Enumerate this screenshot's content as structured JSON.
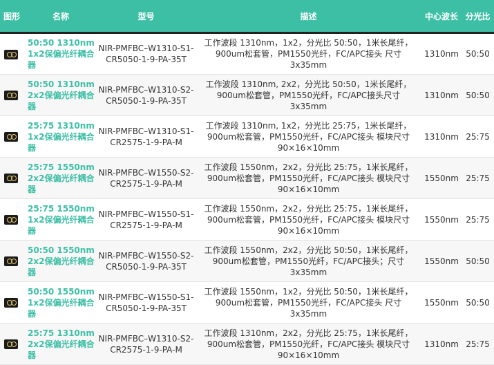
{
  "headers": {
    "shape": "图形",
    "name": "名称",
    "model": "型号",
    "desc": "描述",
    "wavelength": "中心波长",
    "ratio": "分光比"
  },
  "colors": {
    "accent": "#3dbfa6",
    "header_text": "#ffffff"
  },
  "rows": [
    {
      "icon": "coupler-thumbnail",
      "name": "50:50 1310nm 1x2保偏光纤耦合器",
      "model": "NIR-PMFBC–W1310-S1-CR5050-1-9-PA-35T",
      "desc": "工作波段 1310nm，1x2，分光比 50:50，1米长尾纤，900um松套管，PM1550光纤，FC/APC接头 尺寸 3x35mm",
      "wavelength": "1310nm",
      "ratio": "50:50"
    },
    {
      "icon": "coupler-thumbnail",
      "name": "50:50 1310nm 2x2保偏光纤耦合器",
      "model": "NIR-PMFBC–W1310-S2-CR5050-1-9-PA-35T",
      "desc": "工作波段 1310nm, 2x2，分光比 50:50，1米长尾纤，900um松套管，PM1550光纤，FC/APC接头尺寸 3x35mm",
      "wavelength": "1310nm",
      "ratio": "50:50"
    },
    {
      "icon": "coupler-thumbnail",
      "name": "25:75 1310nm 1x2保偏光纤耦合器",
      "model": "NIR-PMFBC–W1310-S1-CR2575-1-9-PA-M",
      "desc": "工作波段 1310nm, 1x2，分光比 25:75，1米长尾纤，900um松套管，PM1550光纤，FC/APC接头 模块尺寸 90×16×10mm",
      "wavelength": "1310nm",
      "ratio": "25:75"
    },
    {
      "icon": "coupler-thumbnail",
      "name": "25:75 1550nm 2x2保偏光纤耦合器",
      "model": "NIR-PMFBC–W1550-S2-CR2575-1-9-PA-M",
      "desc": "工作波段 1550nm，2x2，分光比 25:75，1米长尾纤，900um松套管，PM1550光纤，FC/APC接头 模块尺寸 90×16×10mm",
      "wavelength": "1550nm",
      "ratio": "25:75"
    },
    {
      "icon": "coupler-thumbnail",
      "name": "25:75 1550nm 1x2保偏光纤耦合器",
      "model": "NIR-PMFBC–W1550-S1-CR2575-1-9-PA-M",
      "desc": "工作波段 1550nm，2x2，分光比 25:75，1米长尾纤，900um松套管，PM1550光纤，FC/APC接头 模块尺寸 90×16×10mm",
      "wavelength": "1550nm",
      "ratio": "25:75"
    },
    {
      "icon": "coupler-thumbnail",
      "name": "50:50 1550nm 2x2保偏光纤耦合器",
      "model": "NIR-PMFBC–W1550-S2-CR5050-1-9-PA-35T",
      "desc": "工作波段 1550nm，2x2，分光比 50:50，1米长尾纤，900um松套管，PM1550光纤，FC/APC接头；尺寸 3x35mm",
      "wavelength": "1550nm",
      "ratio": "50:50"
    },
    {
      "icon": "coupler-thumbnail",
      "name": "50:50 1550nm 1x2保偏光纤耦合器",
      "model": "NIR-PMFBC–W1550-S1-CR5050-1-9-PA-35T",
      "desc": "工作波段 1550nm，1x2，分光比 50:50，1米长尾纤，900um松套管，PM1550光纤，FC/APC接头 尺寸 3x35mm",
      "wavelength": "1550nm",
      "ratio": "50:50"
    },
    {
      "icon": "coupler-thumbnail",
      "name": "25:75 1310nm 2x2保偏光纤耦合器",
      "model": "NIR-PMFBC–W1310-S2-CR2575-1-9-PA-M",
      "desc": "工作波段 1310nm，2x2，分光比 25:75，1米长尾纤，900um松套管，PM1550光纤，FC/APC接头 模块尺寸 90×16×10mm",
      "wavelength": "1310nm",
      "ratio": "25:75"
    }
  ]
}
